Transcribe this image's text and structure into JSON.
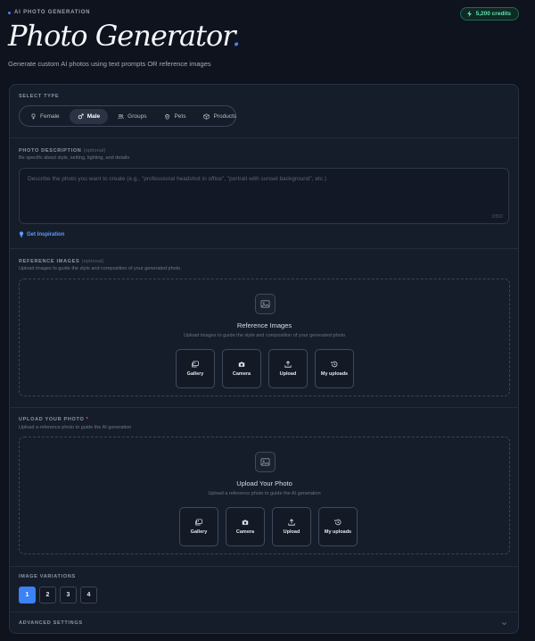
{
  "header": {
    "eyebrow": "AI PHOTO GENERATION",
    "title": "Photo Generator",
    "title_period": ".",
    "subtitle": "Generate custom AI photos using text prompts OR reference images",
    "credits": "5,200 credits"
  },
  "select_type": {
    "label": "SELECT TYPE",
    "tabs": [
      {
        "label": "Female",
        "icon": "female-icon",
        "active": false
      },
      {
        "label": "Male",
        "icon": "male-icon",
        "active": true
      },
      {
        "label": "Groups",
        "icon": "groups-icon",
        "active": false
      },
      {
        "label": "Pets",
        "icon": "paw-icon",
        "active": false
      },
      {
        "label": "Products",
        "icon": "box-icon",
        "active": false
      }
    ]
  },
  "description": {
    "label": "PHOTO DESCRIPTION",
    "optional": "(optional)",
    "help": "Be specific about style, setting, lighting, and details",
    "placeholder": "Describe the photo you want to create (e.g., \"professional headshot in office\", \"portrait with sunset background\", etc.)",
    "counter": "0/500",
    "inspiration": "Get Inspiration"
  },
  "reference": {
    "label": "REFERENCE IMAGES",
    "optional": "(optional)",
    "help": "Upload images to guide the style and composition of your generated photo",
    "title": "Reference Images",
    "sub": "Upload images to guide the style and composition of your generated photo",
    "options": [
      {
        "label": "Gallery",
        "icon": "gallery-icon"
      },
      {
        "label": "Camera",
        "icon": "camera-icon"
      },
      {
        "label": "Upload",
        "icon": "upload-icon"
      },
      {
        "label": "My uploads",
        "icon": "history-icon"
      }
    ]
  },
  "upload": {
    "label": "UPLOAD YOUR PHOTO",
    "required": "*",
    "help": "Upload a reference photo to guide the AI generation",
    "title": "Upload Your Photo",
    "sub": "Upload a reference photo to guide the AI generation",
    "options": [
      {
        "label": "Gallery",
        "icon": "gallery-icon"
      },
      {
        "label": "Camera",
        "icon": "camera-icon"
      },
      {
        "label": "Upload",
        "icon": "upload-icon"
      },
      {
        "label": "My uploads",
        "icon": "history-icon"
      }
    ]
  },
  "variations": {
    "label": "IMAGE VARIATIONS",
    "values": [
      "1",
      "2",
      "3",
      "4"
    ],
    "selected": "1"
  },
  "advanced": {
    "label": "ADVANCED SETTINGS"
  },
  "colors": {
    "accent": "#3b82f6",
    "credits_green": "#5fe0b0",
    "background": "#0e131d",
    "panel": "#161d2a"
  }
}
